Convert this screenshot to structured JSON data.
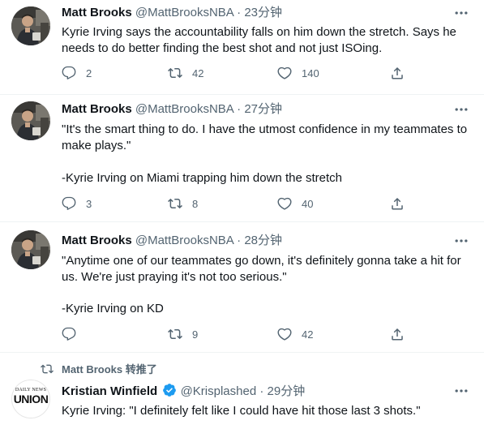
{
  "tweets": [
    {
      "name": "Matt Brooks",
      "handle": "@MattBrooksNBA",
      "time": "23分钟",
      "text": "Kyrie Irving says the accountability falls on him down the stretch. Says he needs to do better finding the best shot and not just ISOing.",
      "replies": "2",
      "retweets": "42",
      "likes": "140"
    },
    {
      "name": "Matt Brooks",
      "handle": "@MattBrooksNBA",
      "time": "27分钟",
      "text_lines": [
        "\"It's the smart thing to do. I have the utmost confidence in my teammates to make plays.\"",
        "-Kyrie Irving on Miami trapping him down the stretch"
      ],
      "replies": "3",
      "retweets": "8",
      "likes": "40"
    },
    {
      "name": "Matt Brooks",
      "handle": "@MattBrooksNBA",
      "time": "28分钟",
      "text_lines": [
        "\"Anytime one of our teammates go down, it's definitely gonna take a hit for us. We're just praying it's not too serious.\"",
        "-Kyrie Irving on KD"
      ],
      "replies": "",
      "retweets": "9",
      "likes": "42"
    },
    {
      "retweeted_by": "Matt Brooks 转推了",
      "name": "Kristian Winfield",
      "handle": "@Krisplashed",
      "time": "29分钟",
      "text": "Kyrie Irving: \"I definitely felt like I could have hit those last 3 shots.\"",
      "logo_top": "DAILY NEWS",
      "logo_main": "UNION"
    }
  ],
  "separator": "·",
  "colors": {
    "text": "#0f1419",
    "secondary": "#536471",
    "border": "#eff3f4",
    "verified": "#1d9bf0"
  }
}
